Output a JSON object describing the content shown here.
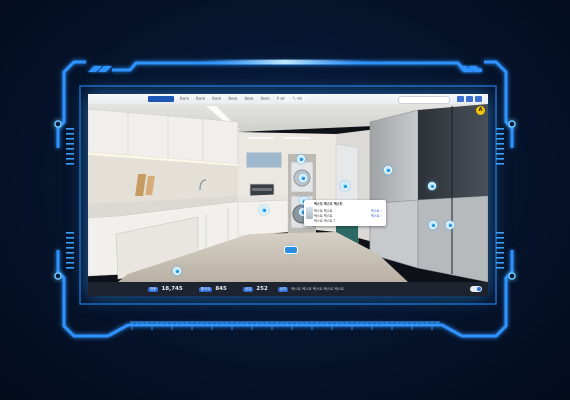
{
  "app": {
    "watermark_text": "TEXT",
    "nav_items": [
      "Item",
      "Item",
      "Item",
      "Item",
      "Item",
      "Item",
      "Item",
      "Item"
    ],
    "corner_badge": "A"
  },
  "popup": {
    "title": "텍스트 텍스트 텍스트",
    "rows": [
      {
        "text": "텍스트 텍스트",
        "link": "텍스트 ›"
      },
      {
        "text": "텍스트 텍스트",
        "link": "텍스트 ›"
      },
      {
        "text": "텍스트 텍스트 ?",
        "link": ""
      }
    ]
  },
  "status": {
    "stats": [
      {
        "chip": "방문",
        "value": "18,745"
      },
      {
        "chip": "좋아요",
        "value": "845"
      },
      {
        "chip": "공유",
        "value": "252"
      }
    ],
    "notice_chip": "공지",
    "notice_text": "텍스트 텍스트 텍스트 텍스트 텍스트"
  },
  "colors": {
    "hud_frame": "#2f93ff",
    "hud_glow": "#7fd0ff",
    "background": "#061630",
    "accent": "#2f6fd6"
  }
}
